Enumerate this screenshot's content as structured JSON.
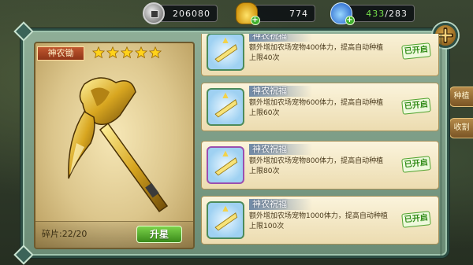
{
  "resources": {
    "silver": "206080",
    "gold": "774",
    "energy_current": "433",
    "energy_max": "/283"
  },
  "item": {
    "name": "神农锄",
    "stars": 5,
    "shards": "碎片:22/20",
    "upgrade_label": "升星"
  },
  "blessings": [
    {
      "title": "神农祝福",
      "desc": "额外增加农场宠物400体力，提高自动种植上限40次",
      "status": "已开启",
      "frame": "green"
    },
    {
      "title": "神农祝福",
      "desc": "额外增加农场宠物600体力，提高自动种植上限60次",
      "status": "已开启",
      "frame": "green"
    },
    {
      "title": "神农祝福",
      "desc": "额外增加农场宠物800体力，提高自动种植上限80次",
      "status": "已开启",
      "frame": "purple"
    },
    {
      "title": "神农祝福",
      "desc": "额外增加农场宠物1000体力，提高自动种植上限100次",
      "status": "已开启",
      "frame": "green"
    }
  ],
  "side_tabs": [
    "种植",
    "收割"
  ],
  "colors": {
    "panel": "#7fa087",
    "status_green": "#2f8a16",
    "accent_gold": "#e0b332"
  }
}
